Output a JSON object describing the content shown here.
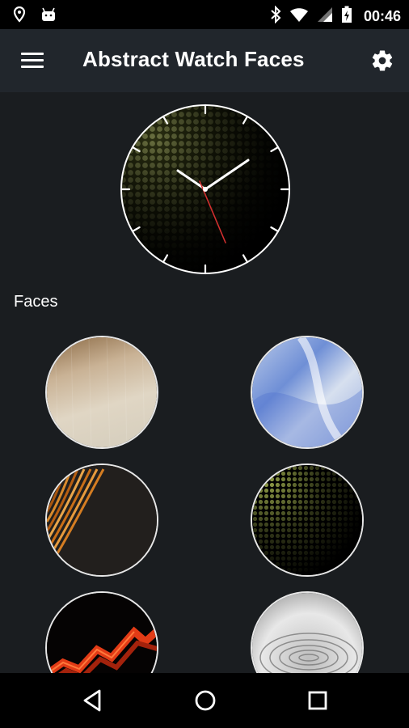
{
  "status_bar": {
    "time": "00:46",
    "icons": [
      "location-icon",
      "android-icon",
      "bluetooth-icon",
      "wifi-icon",
      "signal-icon",
      "battery-icon"
    ]
  },
  "app_bar": {
    "title": "Abstract Watch Faces",
    "menu_icon": "menu-icon",
    "settings_icon": "gear-icon"
  },
  "main": {
    "section_label": "Faces",
    "faces": [
      {
        "id": "face-beige-texture"
      },
      {
        "id": "face-blue-silk"
      },
      {
        "id": "face-orange-waves"
      },
      {
        "id": "face-green-dots"
      },
      {
        "id": "face-red-flame"
      },
      {
        "id": "face-silver-swirl"
      }
    ]
  },
  "nav_bar": {
    "icons": [
      "back-icon",
      "home-icon",
      "recents-icon"
    ]
  },
  "colors": {
    "background": "#1a1d20",
    "app_bar": "#21262c",
    "accent_red": "#d32f2f"
  }
}
